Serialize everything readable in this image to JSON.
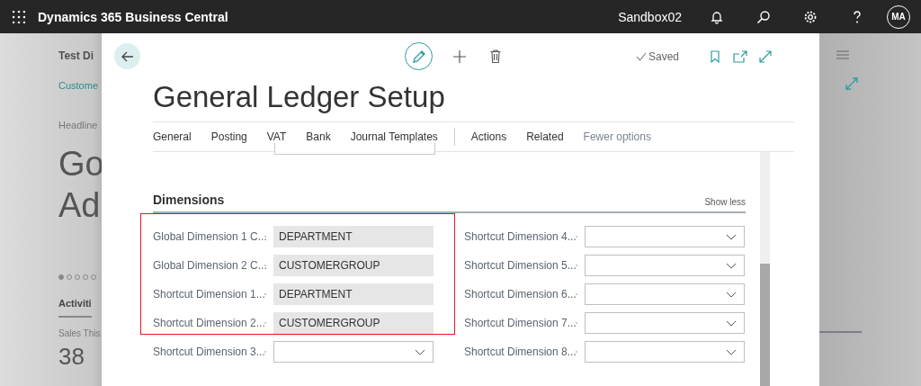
{
  "app_bar": {
    "product": "Dynamics 365 Business Central",
    "environment": "Sandbox02",
    "avatar": "MA"
  },
  "background_page": {
    "title": "Test Di",
    "link": "Custome",
    "headline_label": "Headline",
    "headline_lines": [
      "Go",
      "Ad"
    ],
    "carousel": [
      {
        "selected": true
      },
      {
        "selected": false
      },
      {
        "selected": false
      },
      {
        "selected": false
      },
      {
        "selected": false
      }
    ],
    "section": "Activiti",
    "cue_label": "Sales This",
    "cue_value": "38"
  },
  "dialog": {
    "status": "Saved",
    "title": "General Ledger Setup",
    "action_bar": {
      "tabs": [
        "General",
        "Posting",
        "VAT",
        "Bank",
        "Journal Templates"
      ],
      "menus": [
        "Actions",
        "Related"
      ],
      "toggle": "Fewer options"
    },
    "section": {
      "title": "Dimensions",
      "toggle": "Show less",
      "left_fields": [
        {
          "label": "Global Dimension 1 C...",
          "kind": "readonly",
          "value": "DEPARTMENT"
        },
        {
          "label": "Global Dimension 2 C...",
          "kind": "readonly",
          "value": "CUSTOMERGROUP"
        },
        {
          "label": "Shortcut Dimension 1...",
          "kind": "readonly",
          "value": "DEPARTMENT"
        },
        {
          "label": "Shortcut Dimension 2...",
          "kind": "readonly",
          "value": "CUSTOMERGROUP"
        },
        {
          "label": "Shortcut Dimension 3...",
          "kind": "dropdown"
        }
      ],
      "right_fields": [
        {
          "label": "Shortcut Dimension 4...",
          "kind": "dropdown"
        },
        {
          "label": "Shortcut Dimension 5...",
          "kind": "dropdown"
        },
        {
          "label": "Shortcut Dimension 6...",
          "kind": "dropdown"
        },
        {
          "label": "Shortcut Dimension 7...",
          "kind": "dropdown"
        },
        {
          "label": "Shortcut Dimension 8...",
          "kind": "dropdown"
        }
      ]
    }
  }
}
